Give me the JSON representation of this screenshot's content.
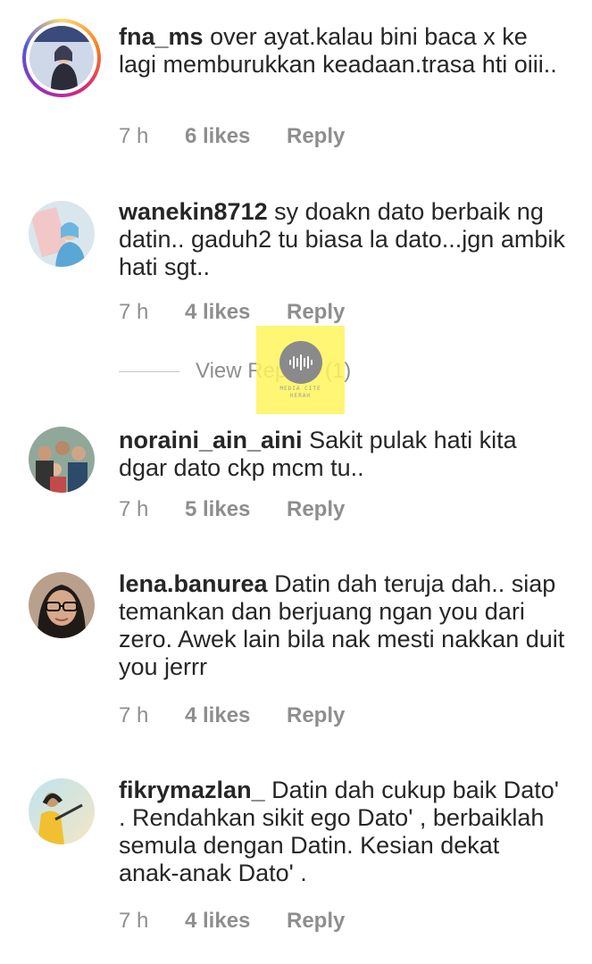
{
  "comments": [
    {
      "username": "fna_ms",
      "text": "over ayat.kalau bini baca x ke lagi memburukkan keadaan.trasa hti oiii..",
      "time": "7 h",
      "likes": "6 likes",
      "reply": "Reply",
      "avatar_ring": true
    },
    {
      "username": "wanekin8712",
      "text": "sy doakn dato berbaik ng datin.. gaduh2 tu biasa la dato...jgn ambik hati sgt..",
      "time": "7 h",
      "likes": "4 likes",
      "reply": "Reply",
      "view_replies": "View Replies (1)"
    },
    {
      "username": "noraini_ain_aini",
      "text": "Sakit pulak hati kita dgar dato ckp mcm tu..",
      "time": "7 h",
      "likes": "5 likes",
      "reply": "Reply"
    },
    {
      "username": "lena.banurea",
      "text": "Datin dah teruja dah.. siap temankan dan berjuang ngan you dari zero. Awek lain bila nak mesti nakkan duit you jerrr",
      "time": "7 h",
      "likes": "4 likes",
      "reply": "Reply"
    },
    {
      "username": "fikrymazlan_",
      "text": "Datin dah cukup baik Dato' . Rendahkan sikit ego Dato' , berbaiklah semula dengan Datin. Kesian dekat anak-anak Dato' .",
      "time": "7 h",
      "likes": "4 likes",
      "reply": "Reply"
    }
  ],
  "watermark": {
    "line1": "MEDIA CITE",
    "line2": "HERAH"
  },
  "colors": {
    "meta_gray": "#8e8e8e",
    "text": "#262626",
    "watermark_bg": "#fff55a"
  }
}
